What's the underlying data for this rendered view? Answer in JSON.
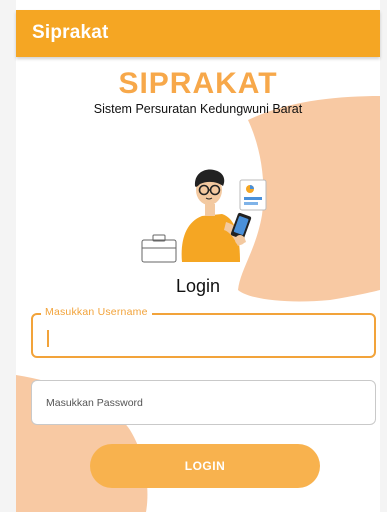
{
  "appbar": {
    "title": "Siprakat"
  },
  "brand": {
    "name": "SIPRAKAT",
    "subtitle": "Sistem Persuratan Kedungwuni Barat"
  },
  "login": {
    "title": "Login",
    "username_label": "Masukkan Username",
    "username_value": "",
    "password_placeholder": "Masukkan Password",
    "button_label": "LOGIN"
  },
  "colors": {
    "primary": "#f5a623",
    "accent": "#f2a33a",
    "blob": "#f8c9a3"
  }
}
